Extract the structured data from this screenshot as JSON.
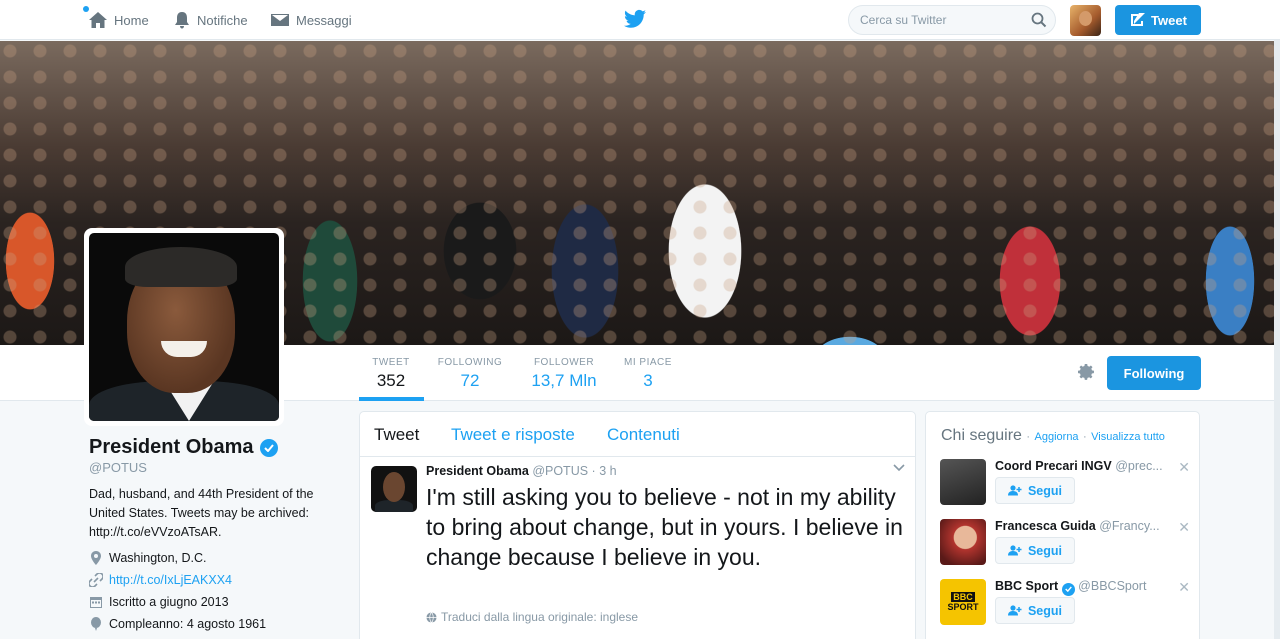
{
  "nav": {
    "home": "Home",
    "notifications": "Notifiche",
    "messages": "Messaggi",
    "search_placeholder": "Cerca su Twitter",
    "tweet_button": "Tweet"
  },
  "profile": {
    "name": "President Obama",
    "handle": "@POTUS",
    "bio": "Dad, husband, and 44th President of the United States. Tweets may be archived: http://t.co/eVVzoATsAR.",
    "location": "Washington, D.C.",
    "website": "http://t.co/IxLjEAKXX4",
    "joined": "Iscritto a giugno 2013",
    "birthday": "Compleanno: 4 agosto 1961"
  },
  "stats": [
    {
      "label": "TWEET",
      "value": "352"
    },
    {
      "label": "FOLLOWING",
      "value": "72"
    },
    {
      "label": "FOLLOWER",
      "value": "13,7 Mln"
    },
    {
      "label": "MI PIACE",
      "value": "3"
    }
  ],
  "following_button": "Following",
  "timeline": {
    "tabs": [
      "Tweet",
      "Tweet e risposte",
      "Contenuti"
    ],
    "tweet": {
      "name": "President Obama",
      "handle": "@POTUS",
      "separator": "·",
      "time": "3 h",
      "text": "I'm still asking you to believe - not in my ability to bring about change, but in yours. I believe in change because I believe in you.",
      "translate": "Traduci dalla lingua originale: inglese"
    }
  },
  "who_to_follow": {
    "title": "Chi seguire",
    "refresh": "Aggiorna",
    "view_all": "Visualizza tutto",
    "dot": "·",
    "follow_label": "Segui",
    "suggestions": [
      {
        "name": "Coord Precari INGV",
        "handle": "@prec...",
        "avatar_color": "#3a3a3a"
      },
      {
        "name": "Francesca Guida",
        "handle": "@Francy...",
        "avatar_color": "#b2342e"
      },
      {
        "name": "BBC Sport",
        "handle": "@BBCSport",
        "avatar_color": "#f5c400",
        "avatar_text": "BBC SPORT"
      }
    ]
  },
  "colors": {
    "accent": "#1da1f2",
    "button": "#1b95e0",
    "text": "#14171a",
    "muted": "#8899a6"
  }
}
